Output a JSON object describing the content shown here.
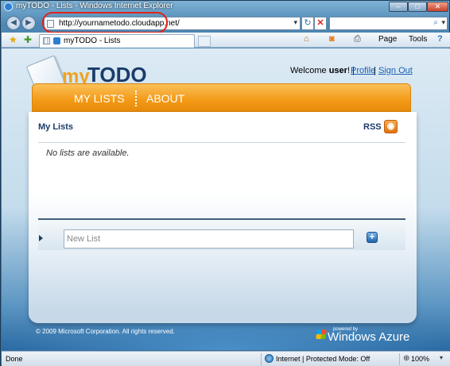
{
  "window": {
    "title": "myTODO - Lists - Windows Internet Explorer",
    "min_glyph": "–",
    "max_glyph": "□",
    "close_glyph": "✕"
  },
  "address_bar": {
    "url": "http://yournametodo.cloudapp.net/",
    "highlight_color": "#e0231b"
  },
  "tab": {
    "label": "myTODO - Lists"
  },
  "command_bar": {
    "page_label": "Page",
    "tools_label": "Tools"
  },
  "page": {
    "logo_my": "my",
    "logo_todo": "TODO",
    "welcome_prefix": "Welcome ",
    "welcome_user": "user",
    "welcome_suffix": "! | ",
    "profile_link": "Profile",
    "separator": "|",
    "signout_link": "Sign Out",
    "nav": {
      "my_lists": "MY LISTS",
      "about": "ABOUT"
    },
    "panel_title": "My Lists",
    "rss_label": "RSS",
    "empty_message": "No lists are available.",
    "new_list_placeholder": "New List",
    "copyright": "© 2009 Microsoft Corporation. All rights reserved.",
    "powered_by": "powered by",
    "azure": "Windows Azure"
  },
  "status_bar": {
    "status": "Done",
    "zone": "Internet | Protected Mode: Off",
    "zoom": "100%"
  },
  "colors": {
    "accent_orange": "#f29a16",
    "brand_navy": "#1b3c6b",
    "link_blue": "#1a5fb4"
  }
}
